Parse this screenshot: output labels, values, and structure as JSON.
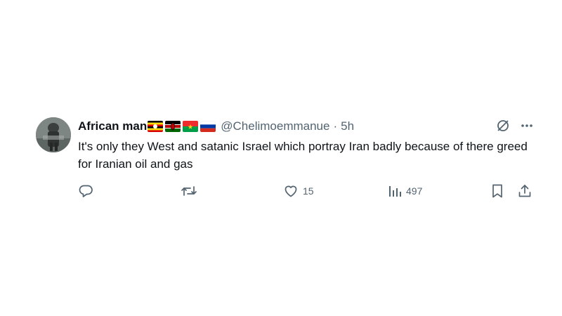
{
  "tweet": {
    "author": {
      "display_name": "African man",
      "flags": [
        "uganda-flag",
        "kenya-flag",
        "burkina-faso-flag",
        "russia-flag"
      ],
      "handle": "@Chelimoemmanue",
      "separator": "·",
      "time": "5h",
      "avatar": "profile-photo"
    },
    "text": "It's only they West and satanic Israel which portray Iran badly because of there greed for Iranian oil and gas",
    "top_icons": [
      "grok-icon",
      "more-icon"
    ],
    "actions": {
      "reply": {
        "icon": "reply-icon",
        "count": ""
      },
      "retweet": {
        "icon": "retweet-icon",
        "count": ""
      },
      "like": {
        "icon": "heart-icon",
        "count": "15"
      },
      "views": {
        "icon": "views-icon",
        "count": "497"
      },
      "bookmark": {
        "icon": "bookmark-icon"
      },
      "share": {
        "icon": "share-icon"
      }
    },
    "colors": {
      "text": "#0f1419",
      "secondary": "#536471",
      "background": "#ffffff"
    }
  }
}
